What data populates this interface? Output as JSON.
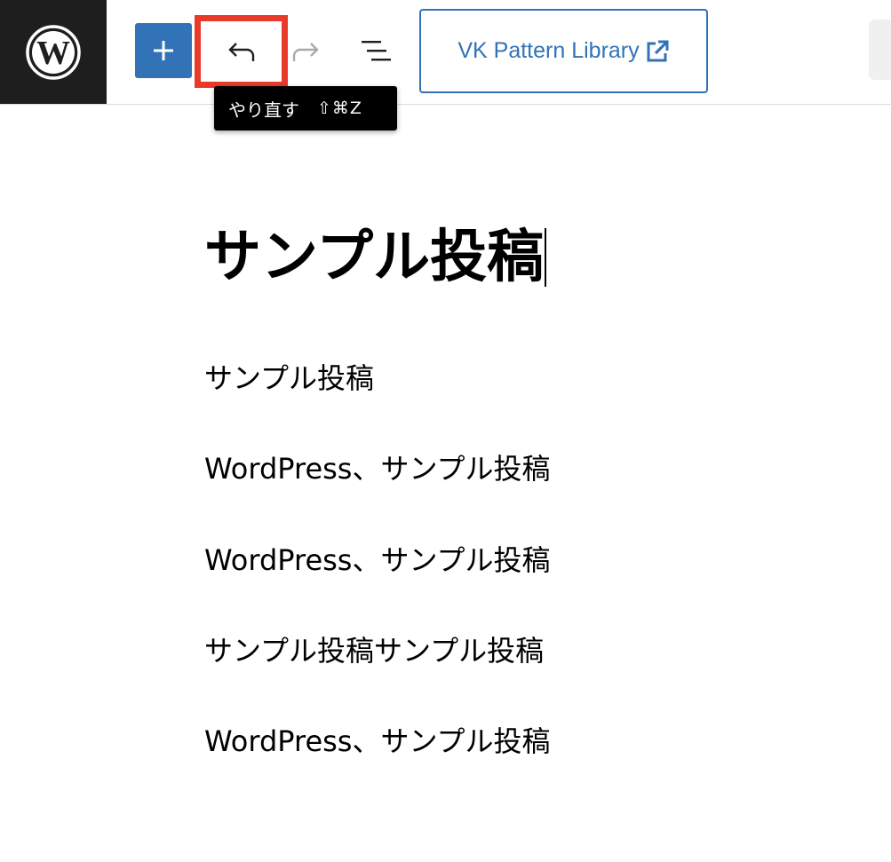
{
  "toolbar": {
    "logo_icon": "wordpress-logo-icon",
    "add_icon": "plus-icon",
    "undo_icon": "undo-icon",
    "redo_icon": "redo-icon",
    "outline_icon": "document-outline-icon",
    "vk_label": "VK Pattern Library",
    "vk_icon": "external-link-icon"
  },
  "tooltip": {
    "label": "やり直す",
    "shortcut": "⇧⌘Z"
  },
  "post": {
    "title": "サンプル投稿",
    "paragraphs": [
      "サンプル投稿",
      "WordPress、サンプル投稿",
      "WordPress、サンプル投稿",
      "サンプル投稿サンプル投稿",
      "WordPress、サンプル投稿"
    ]
  },
  "colors": {
    "accent": "#3173b6",
    "highlight": "#e8392b",
    "logo_bg": "#1e1e1e"
  }
}
